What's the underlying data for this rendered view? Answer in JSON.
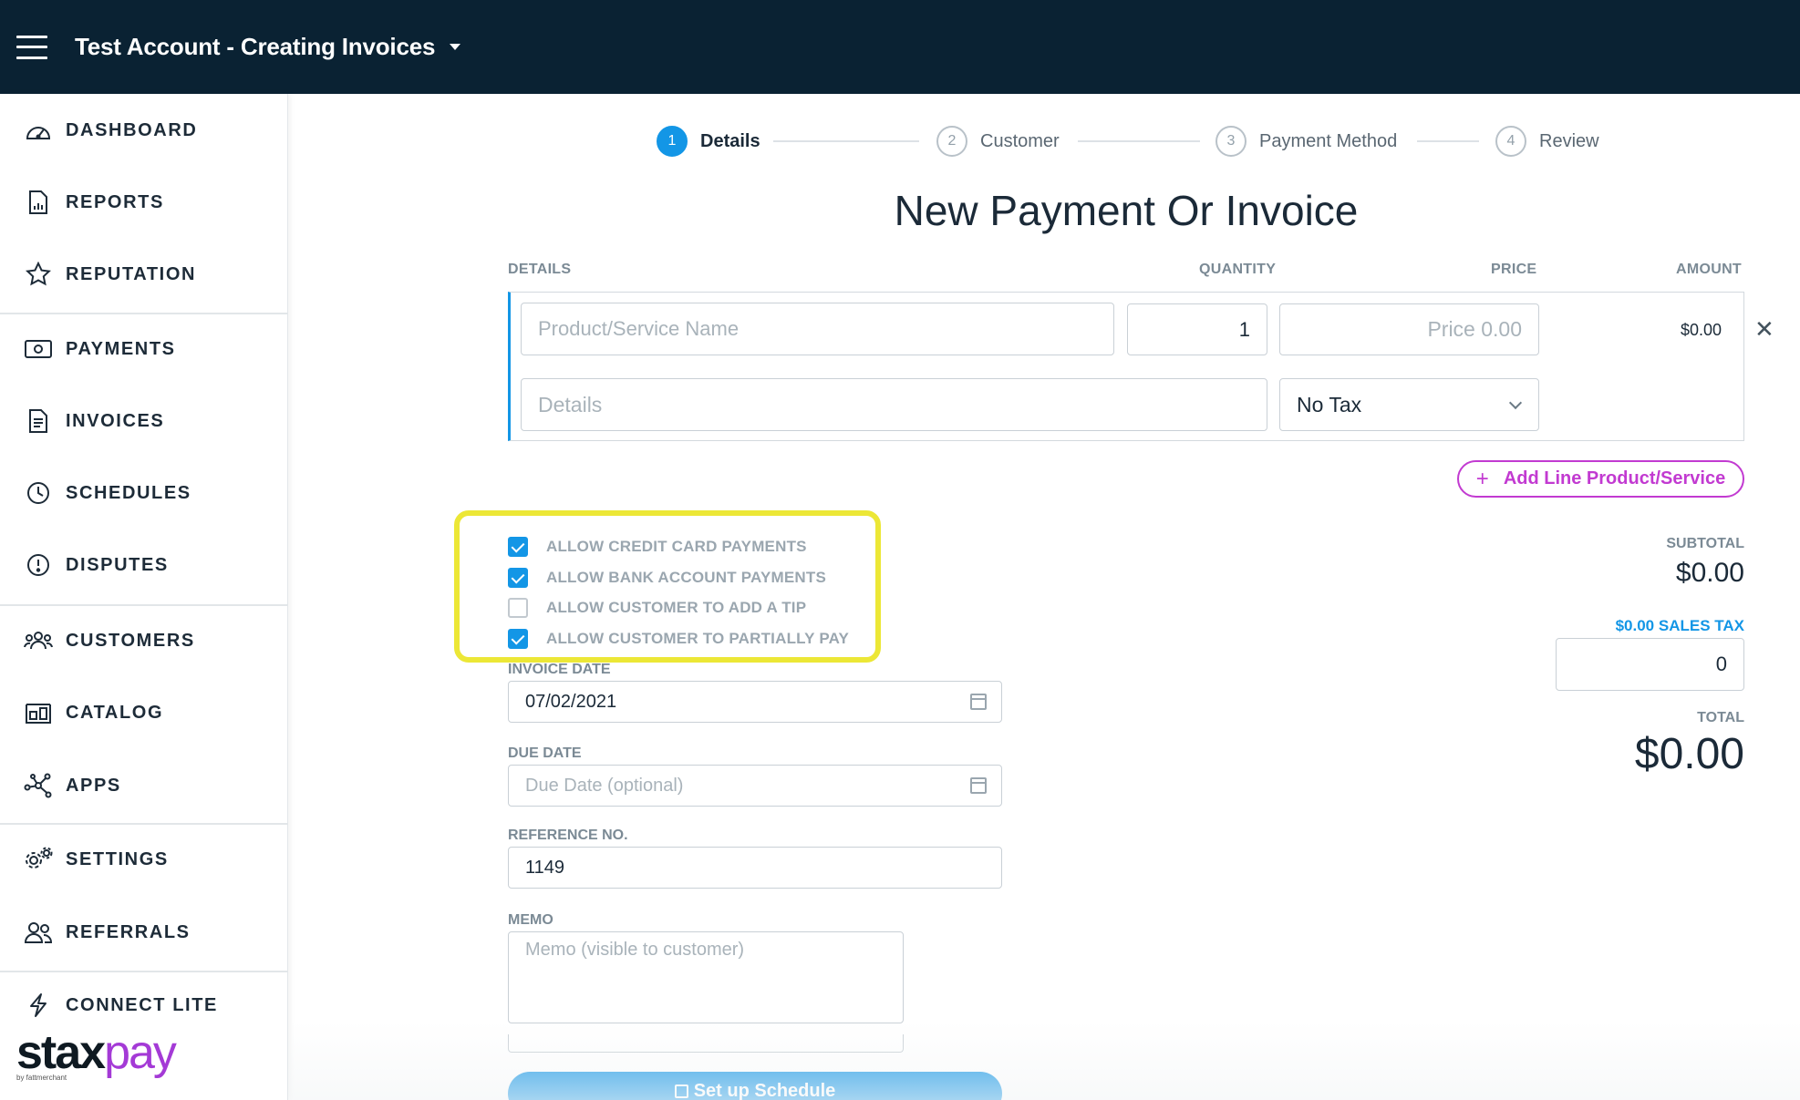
{
  "header": {
    "account_title": "Test Account - Creating Invoices"
  },
  "sidebar": {
    "items": [
      {
        "key": "dashboard",
        "label": "DASHBOARD",
        "icon": "gauge-icon"
      },
      {
        "key": "reports",
        "label": "REPORTS",
        "icon": "report-icon"
      },
      {
        "key": "reputation",
        "label": "REPUTATION",
        "icon": "star-icon"
      },
      {
        "key": "payments",
        "label": "PAYMENTS",
        "icon": "money-icon"
      },
      {
        "key": "invoices",
        "label": "INVOICES",
        "icon": "invoice-icon"
      },
      {
        "key": "schedules",
        "label": "SCHEDULES",
        "icon": "clock-icon"
      },
      {
        "key": "disputes",
        "label": "DISPUTES",
        "icon": "alert-icon"
      },
      {
        "key": "customers",
        "label": "CUSTOMERS",
        "icon": "people-icon"
      },
      {
        "key": "catalog",
        "label": "CATALOG",
        "icon": "catalog-icon"
      },
      {
        "key": "apps",
        "label": "APPS",
        "icon": "network-icon"
      },
      {
        "key": "settings",
        "label": "SETTINGS",
        "icon": "gear-icon"
      },
      {
        "key": "referrals",
        "label": "REFERRALS",
        "icon": "referral-icon"
      },
      {
        "key": "connect-lite",
        "label": "CONNECT LITE",
        "icon": "bolt-icon"
      }
    ],
    "brand": {
      "stax": "stax",
      "pay": "pay",
      "sub": "by fattmerchant"
    }
  },
  "stepper": {
    "steps": [
      {
        "num": "1",
        "label": "Details",
        "active": true
      },
      {
        "num": "2",
        "label": "Customer",
        "active": false
      },
      {
        "num": "3",
        "label": "Payment Method",
        "active": false
      },
      {
        "num": "4",
        "label": "Review",
        "active": false
      }
    ]
  },
  "page_title": "New Payment Or Invoice",
  "line_items": {
    "headers": {
      "details": "DETAILS",
      "quantity": "QUANTITY",
      "price": "PRICE",
      "amount": "AMOUNT"
    },
    "row": {
      "name_placeholder": "Product/Service Name",
      "quantity": "1",
      "price_placeholder": "Price 0.00",
      "amount": "$0.00",
      "details_placeholder": "Details",
      "tax": "No Tax"
    },
    "add_button": "Add Line Product/Service"
  },
  "options": [
    {
      "label": "ALLOW CREDIT CARD PAYMENTS",
      "checked": true
    },
    {
      "label": "ALLOW BANK ACCOUNT PAYMENTS",
      "checked": true
    },
    {
      "label": "ALLOW CUSTOMER TO ADD A TIP",
      "checked": false
    },
    {
      "label": "ALLOW CUSTOMER TO PARTIALLY PAY",
      "checked": true
    }
  ],
  "fields": {
    "invoice_date": {
      "label": "INVOICE DATE",
      "value": "07/02/2021"
    },
    "due_date": {
      "label": "DUE DATE",
      "placeholder": "Due Date (optional)"
    },
    "reference": {
      "label": "REFERENCE NO.",
      "value": "1149"
    },
    "memo": {
      "label": "MEMO",
      "placeholder": "Memo (visible to customer)"
    }
  },
  "schedule_button": "Set up Schedule",
  "totals": {
    "subtotal_label": "SUBTOTAL",
    "subtotal": "$0.00",
    "sales_tax_label": "$0.00 SALES TAX",
    "sales_tax_value": "0",
    "total_label": "TOTAL",
    "total": "$0.00"
  },
  "colors": {
    "topbar": "#0a2233",
    "accent": "#1396e6",
    "brand_purple": "#c23ad1",
    "highlight": "#ece736"
  }
}
